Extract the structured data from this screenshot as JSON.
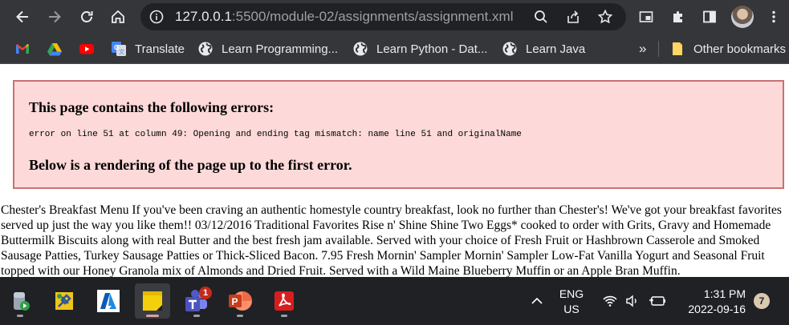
{
  "browser": {
    "address_host": "127.0.0.1",
    "address_path": ":5500/module-02/assignments/assignment.xml",
    "bookmarks": [
      {
        "label": "",
        "icon": "gmail-icon"
      },
      {
        "label": "",
        "icon": "google-drive-icon"
      },
      {
        "label": "",
        "icon": "youtube-icon"
      },
      {
        "label": "Translate",
        "icon": "google-translate-icon"
      },
      {
        "label": "Learn Programming...",
        "icon": "globe-icon"
      },
      {
        "label": "Learn Python - Dat...",
        "icon": "globe-icon"
      },
      {
        "label": "Learn Java",
        "icon": "globe-icon"
      }
    ],
    "overflow_label": "»",
    "other_bookmarks_label": "Other bookmarks"
  },
  "page": {
    "error_heading": "This page contains the following errors:",
    "error_message": "error on line 51 at column 49: Opening and ending tag mismatch: name line 51 and originalName",
    "render_heading": "Below is a rendering of the page up to the first error.",
    "rendered_text": "Chester's Breakfast Menu If you've been craving an authentic homestyle country breakfast, look no further than Chester's! We've got your breakfast favorites served up just the way you like them!! 03/12/2016 Traditional Favorites Rise n' Shine Shine Two Eggs* cooked to order with Grits, Gravy and Homemade Buttermilk Biscuits along with real Butter and the best fresh jam available. Served with your choice of Fresh Fruit or Hashbrown Casserole and Smoked Sausage Patties, Turkey Sausage Patties or Thick-Sliced Bacon. 7.95 Fresh Mornin' Sampler Mornin' Sampler Low-Fat Vanilla Yogurt and Seasonal Fruit topped with our Honey Granola mix of Almonds and Dried Fruit. Served with a Wild Maine Blueberry Muffin or an Apple Bran Muffin."
  },
  "taskbar": {
    "teams_badge": "1",
    "lang_line1": "ENG",
    "lang_line2": "US",
    "time": "1:31 PM",
    "date": "2022-09-16",
    "notification_count": "7"
  },
  "colors": {
    "chrome_bg": "#35363a",
    "omnibox_bg": "#202124",
    "error_bg": "#fdd9d9",
    "error_border": "#c7726f",
    "taskbar_bg": "#202124"
  }
}
